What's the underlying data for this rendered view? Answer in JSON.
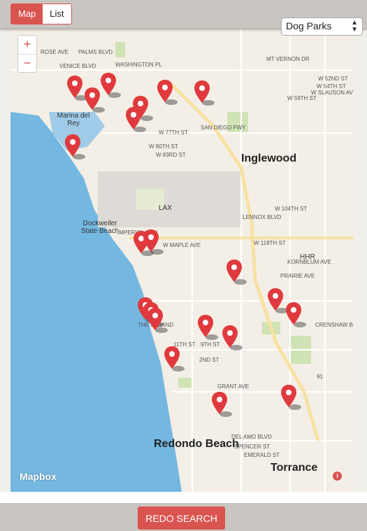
{
  "tabs": {
    "map_label": "Map",
    "list_label": "List"
  },
  "filter": {
    "selected": "Dog Parks"
  },
  "map": {
    "zoom_in": "+",
    "zoom_out": "−",
    "attribution": "Mapbox",
    "info": "i",
    "cities": [
      "Inglewood",
      "Redondo Beach",
      "Torrance"
    ],
    "places": [
      "LAX",
      "HHR",
      "Dockweiler State Beach",
      "Marina del Rey"
    ],
    "streets": [
      "VENICE BLVD",
      "PALMS BLVD",
      "WASHINGTON PL",
      "ROSE AVE",
      "W 77TH ST",
      "W 80TH ST",
      "W 83RD ST",
      "SAN DIEGO FWY",
      "W 104TH ST",
      "LENNOX BLVD",
      "W 118TH ST",
      "IMPERIAL HWY",
      "W MAPLE AVE",
      "THE STRAND",
      "11TH ST",
      "9TH ST",
      "2ND ST",
      "GRANT AVE",
      "DEL AMO BLVD",
      "SPENCER ST",
      "EMERALD ST",
      "W 52ND ST",
      "W 54TH ST",
      "W SLAUSON AVE",
      "W 59TH ST",
      "MT VERNON DR",
      "CRENSHAW BLVD",
      "PRAIRIE AVE",
      "KORNBLUM AVE",
      "91"
    ]
  },
  "pins_count": 21,
  "redo_label": "REDO SEARCH"
}
